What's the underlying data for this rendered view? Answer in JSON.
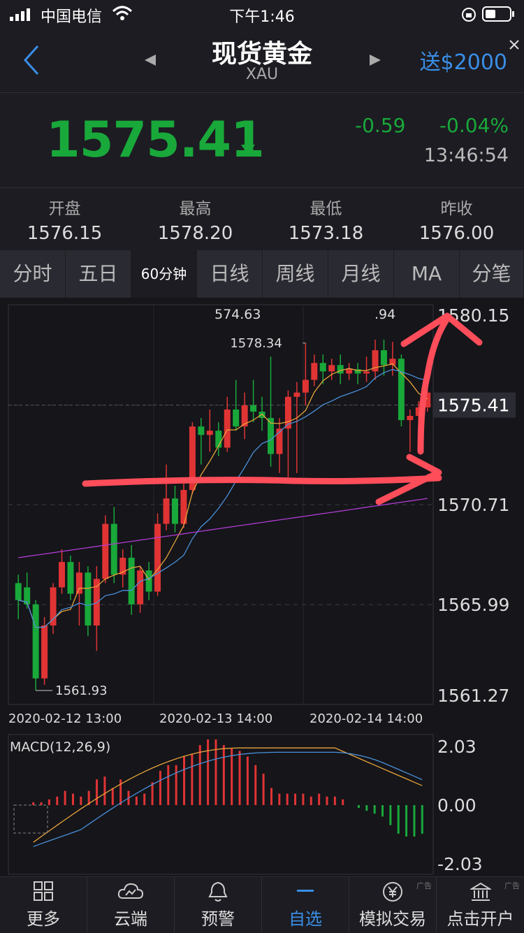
{
  "status": {
    "carrier": "中国电信",
    "time": "下午1:46"
  },
  "header": {
    "title": "现货黄金",
    "subtitle": "XAU",
    "promo": "送$2000"
  },
  "quote": {
    "price": "1575.41",
    "change": "-0.59",
    "change_pct": "-0.04%",
    "time": "13:46:54"
  },
  "ohlc": [
    {
      "label": "开盘",
      "value": "1576.15"
    },
    {
      "label": "最高",
      "value": "1578.20"
    },
    {
      "label": "最低",
      "value": "1573.18"
    },
    {
      "label": "昨收",
      "value": "1576.00"
    }
  ],
  "tabs": [
    "分时",
    "五日",
    "60分钟",
    "日线",
    "周线",
    "月线",
    "MA",
    "分笔"
  ],
  "chart": {
    "y_labels": [
      "1580.15",
      "1575.41",
      "1570.71",
      "1565.99",
      "1561.27"
    ],
    "x_labels": [
      "2020-02-12 13:00",
      "2020-02-13 14:00",
      "2020-02-14 14:00"
    ],
    "hi_label": "1578.34",
    "lo_label": "1561.93",
    "top_labels": [
      "574.63",
      ".94"
    ],
    "current": "1575.41",
    "macd_title": "MACD(12,26,9)",
    "macd_labels": [
      "2.03",
      "0.00",
      "-2.03"
    ]
  },
  "chart_data": {
    "type": "candlestick",
    "ylim": [
      1561.27,
      1580.15
    ],
    "candles": [
      {
        "o": 1567.0,
        "c": 1566.2,
        "h": 1567.4,
        "l": 1565.3
      },
      {
        "o": 1566.8,
        "c": 1566.0,
        "h": 1567.5,
        "l": 1565.8
      },
      {
        "o": 1566.0,
        "c": 1562.5,
        "h": 1566.2,
        "l": 1561.93
      },
      {
        "o": 1562.5,
        "c": 1565.0,
        "h": 1565.4,
        "l": 1562.2
      },
      {
        "o": 1565.0,
        "c": 1566.8,
        "h": 1567.0,
        "l": 1564.6
      },
      {
        "o": 1566.8,
        "c": 1568.0,
        "h": 1568.6,
        "l": 1566.5
      },
      {
        "o": 1568.0,
        "c": 1566.5,
        "h": 1568.3,
        "l": 1566.2
      },
      {
        "o": 1566.5,
        "c": 1567.5,
        "h": 1568.0,
        "l": 1565.0
      },
      {
        "o": 1567.5,
        "c": 1565.0,
        "h": 1567.8,
        "l": 1564.5
      },
      {
        "o": 1565.0,
        "c": 1567.2,
        "h": 1567.8,
        "l": 1563.8
      },
      {
        "o": 1567.2,
        "c": 1569.8,
        "h": 1570.2,
        "l": 1567.0
      },
      {
        "o": 1569.8,
        "c": 1567.4,
        "h": 1570.6,
        "l": 1567.0
      },
      {
        "o": 1567.4,
        "c": 1568.2,
        "h": 1568.6,
        "l": 1566.8
      },
      {
        "o": 1568.2,
        "c": 1566.0,
        "h": 1568.8,
        "l": 1565.5
      },
      {
        "o": 1566.0,
        "c": 1567.6,
        "h": 1567.8,
        "l": 1565.6
      },
      {
        "o": 1567.6,
        "c": 1566.6,
        "h": 1568.0,
        "l": 1566.2
      },
      {
        "o": 1566.6,
        "c": 1569.8,
        "h": 1570.3,
        "l": 1566.4
      },
      {
        "o": 1569.8,
        "c": 1571.0,
        "h": 1572.6,
        "l": 1569.5
      },
      {
        "o": 1571.0,
        "c": 1569.8,
        "h": 1571.6,
        "l": 1569.4
      },
      {
        "o": 1569.8,
        "c": 1571.4,
        "h": 1571.8,
        "l": 1569.6
      },
      {
        "o": 1571.4,
        "c": 1574.4,
        "h": 1574.6,
        "l": 1571.2
      },
      {
        "o": 1574.4,
        "c": 1574.0,
        "h": 1574.8,
        "l": 1572.6
      },
      {
        "o": 1574.0,
        "c": 1574.2,
        "h": 1575.2,
        "l": 1573.2
      },
      {
        "o": 1574.2,
        "c": 1573.4,
        "h": 1574.6,
        "l": 1573.0
      },
      {
        "o": 1573.4,
        "c": 1575.2,
        "h": 1575.8,
        "l": 1573.2
      },
      {
        "o": 1575.2,
        "c": 1574.4,
        "h": 1576.6,
        "l": 1574.2
      },
      {
        "o": 1574.4,
        "c": 1575.4,
        "h": 1576.0,
        "l": 1573.8
      },
      {
        "o": 1575.4,
        "c": 1575.1,
        "h": 1576.6,
        "l": 1574.6
      },
      {
        "o": 1575.1,
        "c": 1574.8,
        "h": 1575.8,
        "l": 1574.2
      },
      {
        "o": 1574.8,
        "c": 1573.1,
        "h": 1577.7,
        "l": 1572.5
      },
      {
        "o": 1573.1,
        "c": 1574.3,
        "h": 1574.8,
        "l": 1572.2
      },
      {
        "o": 1574.3,
        "c": 1575.8,
        "h": 1576.1,
        "l": 1572.0
      },
      {
        "o": 1575.8,
        "c": 1576.0,
        "h": 1576.5,
        "l": 1572.2
      },
      {
        "o": 1576.0,
        "c": 1576.6,
        "h": 1578.34,
        "l": 1575.4
      },
      {
        "o": 1576.6,
        "c": 1577.4,
        "h": 1577.8,
        "l": 1576.3
      },
      {
        "o": 1577.4,
        "c": 1577.0,
        "h": 1577.8,
        "l": 1576.4
      },
      {
        "o": 1577.0,
        "c": 1577.3,
        "h": 1577.6,
        "l": 1576.6
      },
      {
        "o": 1577.3,
        "c": 1576.9,
        "h": 1577.8,
        "l": 1576.4
      },
      {
        "o": 1576.9,
        "c": 1577.1,
        "h": 1577.4,
        "l": 1576.6
      },
      {
        "o": 1577.1,
        "c": 1576.9,
        "h": 1577.4,
        "l": 1576.4
      },
      {
        "o": 1576.9,
        "c": 1577.0,
        "h": 1577.7,
        "l": 1576.5
      },
      {
        "o": 1577.0,
        "c": 1578.0,
        "h": 1578.5,
        "l": 1576.6
      },
      {
        "o": 1578.0,
        "c": 1577.3,
        "h": 1578.5,
        "l": 1576.8
      },
      {
        "o": 1577.3,
        "c": 1577.6,
        "h": 1578.4,
        "l": 1576.8
      },
      {
        "o": 1577.6,
        "c": 1574.7,
        "h": 1577.8,
        "l": 1574.4
      },
      {
        "o": 1574.7,
        "c": 1574.9,
        "h": 1575.2,
        "l": 1573.2
      },
      {
        "o": 1574.9,
        "c": 1575.3,
        "h": 1575.6,
        "l": 1574.6
      },
      {
        "o": 1575.3,
        "c": 1576.0,
        "h": 1576.2,
        "l": 1575.1
      }
    ],
    "macd_hist": [
      0.1,
      0.1,
      0.2,
      0.3,
      0.5,
      0.4,
      0.3,
      0.5,
      0.9,
      1.0,
      0.6,
      0.9,
      0.5,
      0.3,
      0.4,
      0.8,
      1.2,
      1.4,
      1.4,
      1.7,
      1.8,
      2.1,
      2.3,
      2.3,
      2.1,
      2.0,
      1.9,
      1.7,
      1.4,
      1.1,
      0.6,
      0.4,
      0.4,
      0.4,
      0.4,
      0.3,
      0.4,
      0.3,
      0.3,
      0.2,
      0.0,
      -0.1,
      -0.2,
      -0.3,
      -0.4,
      -0.7,
      -1.0,
      -1.1,
      -1.1,
      -1.0
    ]
  },
  "nav": [
    {
      "label": "更多",
      "icon": "grid-icon"
    },
    {
      "label": "云端",
      "icon": "cloud-icon"
    },
    {
      "label": "预警",
      "icon": "bell-icon"
    },
    {
      "label": "自选",
      "icon": "dash-icon"
    },
    {
      "label": "模拟交易",
      "icon": "yen-icon"
    },
    {
      "label": "点击开户",
      "icon": "bank-icon"
    }
  ],
  "nav_ad": "广告",
  "colors": {
    "up": "#e03434",
    "down": "#19a83a",
    "accent": "#3a8ee6",
    "annotation": "#ff4d5a"
  }
}
